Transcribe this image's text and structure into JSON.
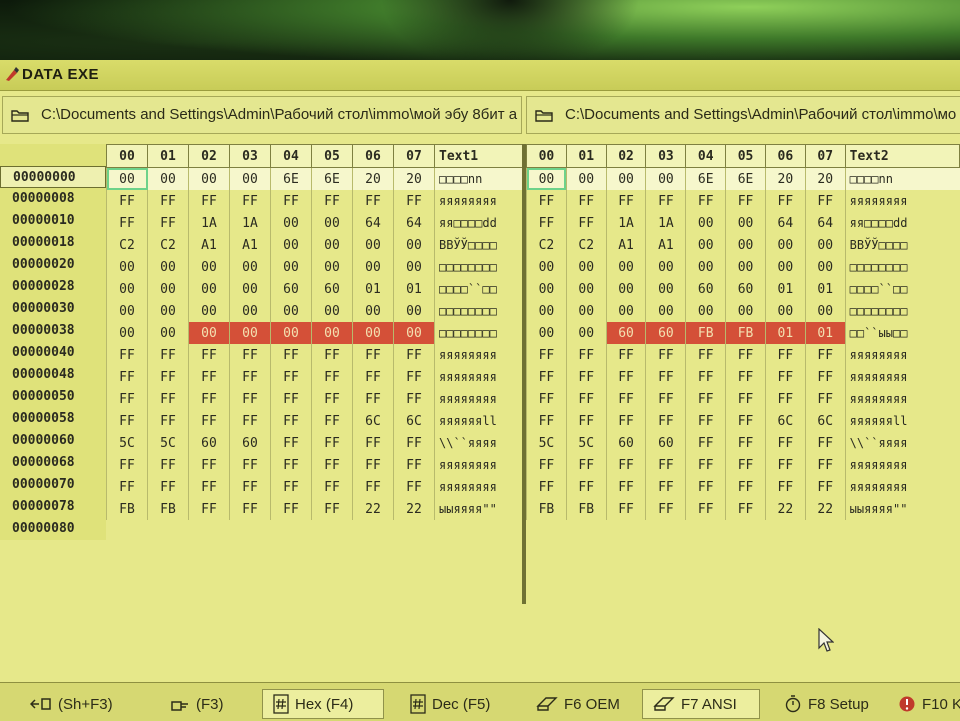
{
  "window": {
    "title": "DATA EXE"
  },
  "paths": {
    "left": "C:\\Documents and Settings\\Admin\\Рабочий стол\\immo\\мой эбу 8бит а",
    "right": "C:\\Documents and Settings\\Admin\\Рабочий стол\\immo\\мо"
  },
  "columns": [
    "00",
    "01",
    "02",
    "03",
    "04",
    "05",
    "06",
    "07"
  ],
  "left_text_header": "Text1",
  "right_text_header": "Text2",
  "addresses": [
    "00000000",
    "00000008",
    "00000010",
    "00000018",
    "00000020",
    "00000028",
    "00000030",
    "00000038",
    "00000040",
    "00000048",
    "00000050",
    "00000058",
    "00000060",
    "00000068",
    "00000070",
    "00000078",
    "00000080"
  ],
  "left_rows": [
    {
      "bytes": [
        "00",
        "00",
        "00",
        "00",
        "6E",
        "6E",
        "20",
        "20"
      ],
      "text": "□□□□nn"
    },
    {
      "bytes": [
        "FF",
        "FF",
        "FF",
        "FF",
        "FF",
        "FF",
        "FF",
        "FF"
      ],
      "text": "яяяяяяяя"
    },
    {
      "bytes": [
        "FF",
        "FF",
        "1A",
        "1A",
        "00",
        "00",
        "64",
        "64"
      ],
      "text": "яя□□□□dd"
    },
    {
      "bytes": [
        "C2",
        "C2",
        "A1",
        "A1",
        "00",
        "00",
        "00",
        "00"
      ],
      "text": "ВВЎЎ□□□□"
    },
    {
      "bytes": [
        "00",
        "00",
        "00",
        "00",
        "00",
        "00",
        "00",
        "00"
      ],
      "text": "□□□□□□□□"
    },
    {
      "bytes": [
        "00",
        "00",
        "00",
        "00",
        "60",
        "60",
        "01",
        "01"
      ],
      "text": "□□□□``□□"
    },
    {
      "bytes": [
        "00",
        "00",
        "00",
        "00",
        "00",
        "00",
        "00",
        "00"
      ],
      "text": "□□□□□□□□"
    },
    {
      "bytes": [
        "00",
        "00",
        "00",
        "00",
        "00",
        "00",
        "00",
        "00"
      ],
      "text": "□□□□□□□□"
    },
    {
      "bytes": [
        "FF",
        "FF",
        "FF",
        "FF",
        "FF",
        "FF",
        "FF",
        "FF"
      ],
      "text": "яяяяяяяя"
    },
    {
      "bytes": [
        "FF",
        "FF",
        "FF",
        "FF",
        "FF",
        "FF",
        "FF",
        "FF"
      ],
      "text": "яяяяяяяя"
    },
    {
      "bytes": [
        "FF",
        "FF",
        "FF",
        "FF",
        "FF",
        "FF",
        "FF",
        "FF"
      ],
      "text": "яяяяяяяя"
    },
    {
      "bytes": [
        "FF",
        "FF",
        "FF",
        "FF",
        "FF",
        "FF",
        "6C",
        "6C"
      ],
      "text": "яяяяяяll"
    },
    {
      "bytes": [
        "5C",
        "5C",
        "60",
        "60",
        "FF",
        "FF",
        "FF",
        "FF"
      ],
      "text": "\\\\``яяяя"
    },
    {
      "bytes": [
        "FF",
        "FF",
        "FF",
        "FF",
        "FF",
        "FF",
        "FF",
        "FF"
      ],
      "text": "яяяяяяяя"
    },
    {
      "bytes": [
        "FF",
        "FF",
        "FF",
        "FF",
        "FF",
        "FF",
        "FF",
        "FF"
      ],
      "text": "яяяяяяяя"
    },
    {
      "bytes": [
        "FB",
        "FB",
        "FF",
        "FF",
        "FF",
        "FF",
        "22",
        "22"
      ],
      "text": "ыыяяяя\"\""
    }
  ],
  "right_rows": [
    {
      "bytes": [
        "00",
        "00",
        "00",
        "00",
        "6E",
        "6E",
        "20",
        "20"
      ],
      "text": "□□□□nn"
    },
    {
      "bytes": [
        "FF",
        "FF",
        "FF",
        "FF",
        "FF",
        "FF",
        "FF",
        "FF"
      ],
      "text": "яяяяяяяя"
    },
    {
      "bytes": [
        "FF",
        "FF",
        "1A",
        "1A",
        "00",
        "00",
        "64",
        "64"
      ],
      "text": "яя□□□□dd"
    },
    {
      "bytes": [
        "C2",
        "C2",
        "A1",
        "A1",
        "00",
        "00",
        "00",
        "00"
      ],
      "text": "ВВЎЎ□□□□"
    },
    {
      "bytes": [
        "00",
        "00",
        "00",
        "00",
        "00",
        "00",
        "00",
        "00"
      ],
      "text": "□□□□□□□□"
    },
    {
      "bytes": [
        "00",
        "00",
        "00",
        "00",
        "60",
        "60",
        "01",
        "01"
      ],
      "text": "□□□□``□□"
    },
    {
      "bytes": [
        "00",
        "00",
        "00",
        "00",
        "00",
        "00",
        "00",
        "00"
      ],
      "text": "□□□□□□□□"
    },
    {
      "bytes": [
        "00",
        "00",
        "60",
        "60",
        "FB",
        "FB",
        "01",
        "01"
      ],
      "text": "□□``ыы□□"
    },
    {
      "bytes": [
        "FF",
        "FF",
        "FF",
        "FF",
        "FF",
        "FF",
        "FF",
        "FF"
      ],
      "text": "яяяяяяяя"
    },
    {
      "bytes": [
        "FF",
        "FF",
        "FF",
        "FF",
        "FF",
        "FF",
        "FF",
        "FF"
      ],
      "text": "яяяяяяяя"
    },
    {
      "bytes": [
        "FF",
        "FF",
        "FF",
        "FF",
        "FF",
        "FF",
        "FF",
        "FF"
      ],
      "text": "яяяяяяяя"
    },
    {
      "bytes": [
        "FF",
        "FF",
        "FF",
        "FF",
        "FF",
        "FF",
        "6C",
        "6C"
      ],
      "text": "яяяяяяll"
    },
    {
      "bytes": [
        "5C",
        "5C",
        "60",
        "60",
        "FF",
        "FF",
        "FF",
        "FF"
      ],
      "text": "\\\\``яяяя"
    },
    {
      "bytes": [
        "FF",
        "FF",
        "FF",
        "FF",
        "FF",
        "FF",
        "FF",
        "FF"
      ],
      "text": "яяяяяяяя"
    },
    {
      "bytes": [
        "FF",
        "FF",
        "FF",
        "FF",
        "FF",
        "FF",
        "FF",
        "FF"
      ],
      "text": "яяяяяяяя"
    },
    {
      "bytes": [
        "FB",
        "FB",
        "FF",
        "FF",
        "FF",
        "FF",
        "22",
        "22"
      ],
      "text": "ыыяяяя\"\""
    }
  ],
  "diff_row_index": 7,
  "diff_cols": [
    2,
    3,
    4,
    5,
    6,
    7
  ],
  "statusbar": {
    "b1": "(Sh+F3)",
    "b2": "(F3)",
    "b3": "Hex (F4)",
    "b4": "Dec (F5)",
    "b5": "F6 OEM",
    "b6": "F7 ANSI",
    "b7": "F8 Setup",
    "b8": "F10 K"
  },
  "colors": {
    "diff": "#d45038",
    "selection": "#6ed28a",
    "background": "#e6e88a"
  }
}
